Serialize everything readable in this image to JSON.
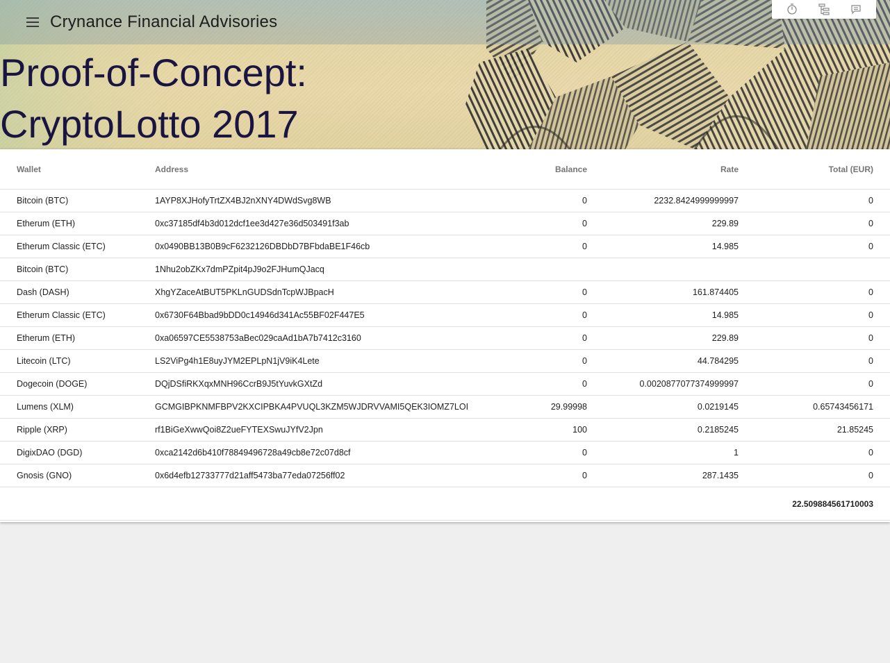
{
  "app": {
    "title": "Crynance Financial Advisories",
    "page_title": "Proof-of-Concept:\nCryptoLotto 2017"
  },
  "toolbar": {
    "menu_icon": "menu-icon",
    "actions": [
      "timer-icon",
      "tree-structure-icon",
      "comment-icon"
    ]
  },
  "colors": {
    "title_text": "#1a1540",
    "header_text": "#757575"
  },
  "table": {
    "columns": [
      "Wallet",
      "Address",
      "Balance",
      "Rate",
      "Total (EUR)"
    ],
    "rows": [
      {
        "wallet": "Bitcoin (BTC)",
        "address": "1AYP8XJHofyTrtZX4BJ2nXNY4DWdSvg8WB",
        "balance": "0",
        "rate": "2232.8424999999997",
        "total": "0"
      },
      {
        "wallet": "Etherum (ETH)",
        "address": "0xc37185df4b3d012dcf1ee3d427e36d503491f3ab",
        "balance": "0",
        "rate": "229.89",
        "total": "0"
      },
      {
        "wallet": "Etherum Classic (ETC)",
        "address": "0x0490BB13B0B9cF6232126DBDbD7BFbdaBE1F46cb",
        "balance": "0",
        "rate": "14.985",
        "total": "0"
      },
      {
        "wallet": "Bitcoin (BTC)",
        "address": "1Nhu2obZKx7dmPZpit4pJ9o2FJHumQJacq",
        "balance": "",
        "rate": "",
        "total": ""
      },
      {
        "wallet": "Dash (DASH)",
        "address": "XhgYZaceAtBUT5PKLnGUDSdnTcpWJBpacH",
        "balance": "0",
        "rate": "161.874405",
        "total": "0"
      },
      {
        "wallet": "Etherum Classic (ETC)",
        "address": "0x6730F64Bbad9bDD0c14946d341Ac55BF02F447E5",
        "balance": "0",
        "rate": "14.985",
        "total": "0"
      },
      {
        "wallet": "Etherum (ETH)",
        "address": "0xa06597CE5538753aBec029caAd1bA7b7412c3160",
        "balance": "0",
        "rate": "229.89",
        "total": "0"
      },
      {
        "wallet": "Litecoin (LTC)",
        "address": "LS2ViPg4h1E8uyJYM2EPLpN1jV9iK4Lete",
        "balance": "0",
        "rate": "44.784295",
        "total": "0"
      },
      {
        "wallet": "Dogecoin (DOGE)",
        "address": "DQjDSfiRKXqxMNH96CcrB9J5tYuvkGXtZd",
        "balance": "0",
        "rate": "0.0020877077374999997",
        "total": "0"
      },
      {
        "wallet": "Lumens (XLM)",
        "address": "GCMGIBPKNMFBPV2KXCIPBKA4PVUQL3KZM5WJDRVVAMI5QEK3IOMZ7LOI",
        "balance": "29.99998",
        "rate": "0.0219145",
        "total": "0.65743456171"
      },
      {
        "wallet": "Ripple (XRP)",
        "address": "rf1BiGeXwwQoi8Z2ueFYTEXSwuJYfV2Jpn",
        "balance": "100",
        "rate": "0.2185245",
        "total": "21.85245"
      },
      {
        "wallet": "DigixDAO (DGD)",
        "address": "0xca2142d6b410f78849496728a49cb8e72c07d8cf",
        "balance": "0",
        "rate": "1",
        "total": "0"
      },
      {
        "wallet": "Gnosis (GNO)",
        "address": "0x6d4efb12733777d21aff5473ba77eda07256ff02",
        "balance": "0",
        "rate": "287.1435",
        "total": "0"
      }
    ],
    "grand_total": "22.509884561710003"
  }
}
